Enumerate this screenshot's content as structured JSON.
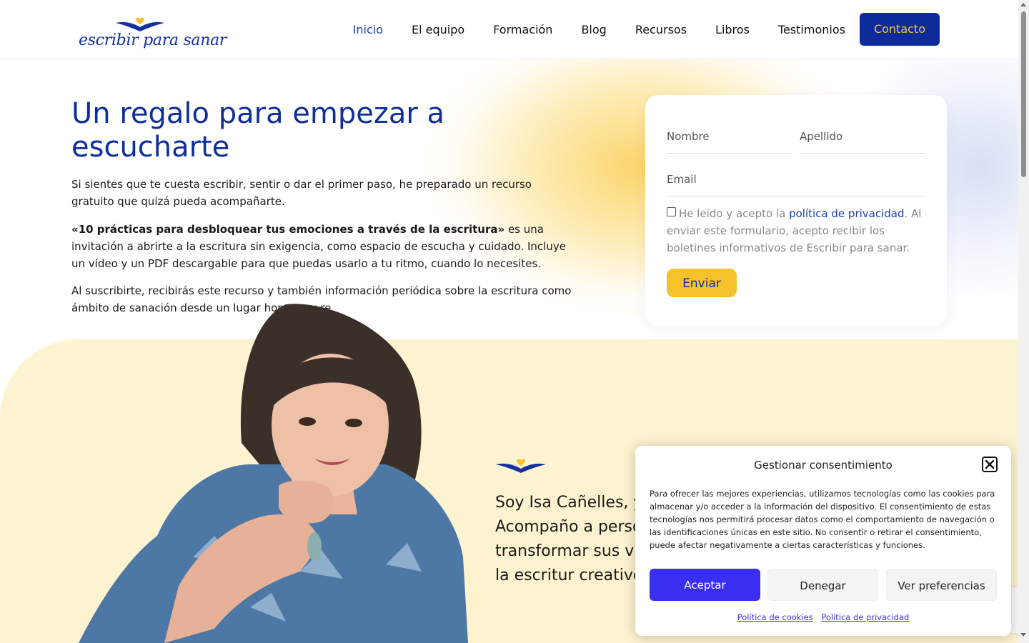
{
  "header": {
    "logo_text": "escribir para sanar",
    "nav": [
      {
        "label": "Inicio"
      },
      {
        "label": "El equipo"
      },
      {
        "label": "Formación"
      },
      {
        "label": "Blog"
      },
      {
        "label": "Recursos"
      },
      {
        "label": "Libros"
      },
      {
        "label": "Testimonios"
      }
    ],
    "cta_label": "Contacto"
  },
  "hero": {
    "title": "Un regalo para empezar a escucharte",
    "p1": "Si sientes que te cuesta escribir, sentir o dar el primer paso, he preparado un recurso gratuito que quizá pueda acompañarte.",
    "p2_bold": "«10 prácticas para desbloquear tus emociones a través de la escritura»",
    "p2_rest": " es una invitación a abrirte a la escritura sin exigencia, como espacio de escucha y cuidado. Incluye un vídeo y un PDF descargable para que puedas usarlo a tu ritmo, cuando lo necesites.",
    "p3": "Al suscribirte, recibirás este recurso y también información periódica sobre la escritura como ámbito de sanación desde un lugar honesto y re"
  },
  "form": {
    "nombre_placeholder": "Nombre",
    "apellido_placeholder": "Apellido",
    "email_placeholder": "Email",
    "consent_pre": "He leido y acepto la ",
    "consent_link": "política de privacidad",
    "consent_post": ". Al enviar este formulario, acepto recibir los boletines informativos de Escribir para sanar.",
    "submit_label": "Enviar"
  },
  "intro": {
    "text": "Soy Isa Cañelles, y t Acompaño a person transformar sus vín través de la escritur creativo."
  },
  "cookie": {
    "title": "Gestionar consentimiento",
    "text": "Para ofrecer las mejores experiencias, utilizamos tecnologías como las cookies para almacenar y/o acceder a la información del dispositivo. El consentimiento de estas tecnologías nos permitirá procesar datos como el comportamiento de navegación o las identificaciones únicas en este sitio. No consentir o retirar el consentimiento, puede afectar negativamente a ciertas características y funciones.",
    "accept": "Aceptar",
    "deny": "Denegar",
    "prefs": "Ver preferencias",
    "link_cookies": "Política de cookies",
    "link_privacy": "Política de privacidad"
  },
  "colors": {
    "brand_blue": "#0e2b9a",
    "brand_yellow": "#f6c22c",
    "cookie_accent": "#3a2ef0",
    "cream": "#fdf3d0"
  },
  "icons": [
    "logo-wings-heart-icon",
    "close-icon",
    "checkbox-icon"
  ]
}
